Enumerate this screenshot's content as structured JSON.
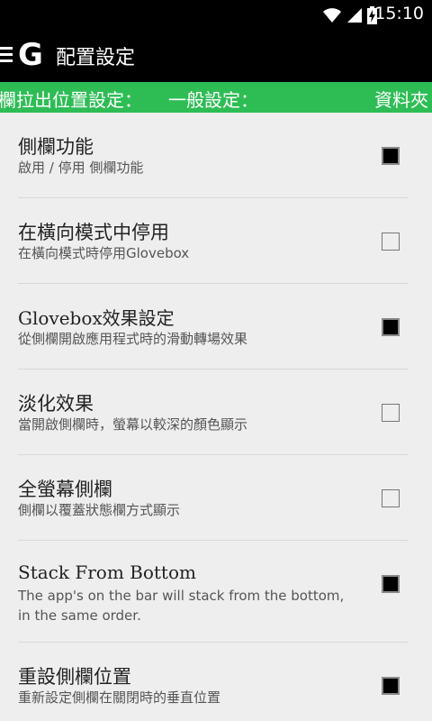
{
  "status_bar": {
    "time": "15:10",
    "icons": [
      "wifi-icon",
      "signal-icon",
      "battery-charging-icon"
    ]
  },
  "action_bar": {
    "logo": "G",
    "title": "配置設定"
  },
  "tabs": [
    {
      "label": "欄拉出位置設定："
    },
    {
      "label": "一般設定："
    },
    {
      "label": "資料夾"
    }
  ],
  "settings": [
    {
      "title": "側欄功能",
      "summary": "啟用 / 停用 側欄功能",
      "checked": true
    },
    {
      "title": "在橫向模式中停用",
      "summary": "在橫向模式時停用Glovebox",
      "checked": false
    },
    {
      "title": "Glovebox效果設定",
      "summary": "從側欄開啟應用程式時的滑動轉場效果",
      "checked": true
    },
    {
      "title": "淡化效果",
      "summary": "當開啟側欄時，螢幕以較深的顏色顯示",
      "checked": false
    },
    {
      "title": "全螢幕側欄",
      "summary": "側欄以覆蓋狀態欄方式顯示",
      "checked": false
    },
    {
      "title": "Stack From Bottom",
      "summary": "The app's on the bar will stack from the bottom, in the same order.",
      "checked": true
    },
    {
      "title": "重設側欄位置",
      "summary": "重新設定側欄在關閉時的垂直位置",
      "checked": true
    }
  ],
  "colors": {
    "accent": "#2ebd55",
    "bar": "#000000",
    "background": "#eeeeee"
  }
}
